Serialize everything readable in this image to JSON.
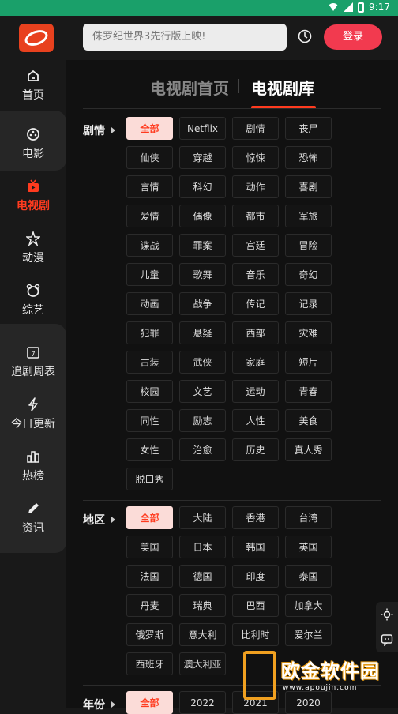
{
  "status_bar": {
    "time": "9:17",
    "color": "#1aa06a"
  },
  "app": {
    "accent": "#ff3b1f",
    "logo_icon": "planet-logo-icon"
  },
  "sidebar": {
    "items": [
      {
        "label": "首页",
        "icon": "home-icon"
      },
      {
        "label": "电影",
        "icon": "film-reel-icon"
      },
      {
        "label": "电视剧",
        "icon": "tv-icon",
        "active": true
      },
      {
        "label": "动漫",
        "icon": "star-icon"
      },
      {
        "label": "综艺",
        "icon": "bear-icon"
      },
      {
        "label": "追剧周表",
        "icon": "calendar-icon"
      },
      {
        "label": "今日更新",
        "icon": "lightning-icon"
      },
      {
        "label": "热榜",
        "icon": "bar-chart-icon"
      },
      {
        "label": "资讯",
        "icon": "pencil-icon"
      }
    ]
  },
  "header": {
    "search_placeholder": "侏罗纪世界3先行版上映!",
    "login_label": "登录"
  },
  "tabs": [
    {
      "label": "电视剧首页"
    },
    {
      "label": "电视剧库",
      "active": true
    }
  ],
  "filters": {
    "genre": {
      "label": "剧情",
      "options": [
        "全部",
        "Netflix",
        "剧情",
        "丧尸",
        "仙侠",
        "穿越",
        "惊悚",
        "恐怖",
        "言情",
        "科幻",
        "动作",
        "喜剧",
        "爱情",
        "偶像",
        "都市",
        "军旅",
        "谍战",
        "罪案",
        "宫廷",
        "冒险",
        "儿童",
        "歌舞",
        "音乐",
        "奇幻",
        "动画",
        "战争",
        "传记",
        "记录",
        "犯罪",
        "悬疑",
        "西部",
        "灾难",
        "古装",
        "武侠",
        "家庭",
        "短片",
        "校园",
        "文艺",
        "运动",
        "青春",
        "同性",
        "励志",
        "人性",
        "美食",
        "女性",
        "治愈",
        "历史",
        "真人秀",
        "脱口秀"
      ],
      "selected": "全部"
    },
    "region": {
      "label": "地区",
      "options": [
        "全部",
        "大陆",
        "香港",
        "台湾",
        "美国",
        "日本",
        "韩国",
        "英国",
        "法国",
        "德国",
        "印度",
        "泰国",
        "丹麦",
        "瑞典",
        "巴西",
        "加拿大",
        "俄罗斯",
        "意大利",
        "比利时",
        "爱尔兰",
        "西班牙",
        "澳大利亚"
      ],
      "selected": "全部"
    },
    "year": {
      "label": "年份",
      "options": [
        "全部",
        "2022",
        "2021",
        "2020"
      ],
      "selected": "全部"
    }
  },
  "floating_tools": [
    "brightness-icon",
    "feedback-icon"
  ],
  "watermark": {
    "text": "欧金软件园",
    "url": "www.apoujin.com"
  }
}
